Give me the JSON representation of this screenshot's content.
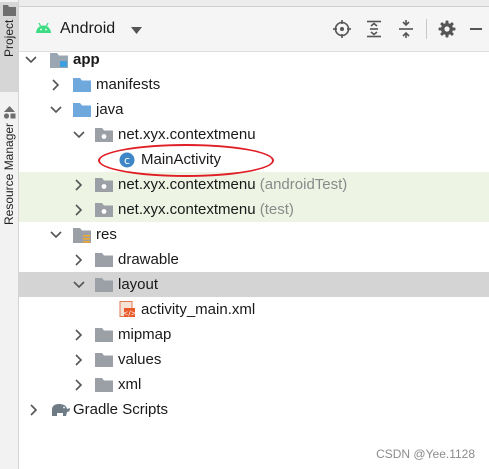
{
  "sidebar": {
    "tabs": [
      {
        "label": "Project"
      },
      {
        "label": "Resource Manager"
      }
    ]
  },
  "header": {
    "view_label": "Android",
    "icons": [
      "target-icon",
      "expand-all-icon",
      "collapse-all-icon",
      "gear-icon",
      "minimize-icon"
    ]
  },
  "tree": {
    "app": "app",
    "manifests": "manifests",
    "java": "java",
    "pkg_main": "net.xyx.contextmenu",
    "main_activity": "MainActivity",
    "pkg_android_test": "net.xyx.contextmenu",
    "android_test_suffix": "(androidTest)",
    "pkg_test": "net.xyx.contextmenu",
    "test_suffix": "(test)",
    "res": "res",
    "drawable": "drawable",
    "layout": "layout",
    "activity_main": "activity_main.xml",
    "mipmap": "mipmap",
    "values": "values",
    "xml": "xml",
    "gradle_scripts": "Gradle Scripts"
  },
  "watermark": "CSDN @Yee.1128",
  "colors": {
    "android_green": "#3ddc84",
    "folder_blue": "#6fa8dc",
    "selection": "#d4d4d4",
    "test_tint": "#edf4e3",
    "annotation_red": "#e01e26"
  }
}
